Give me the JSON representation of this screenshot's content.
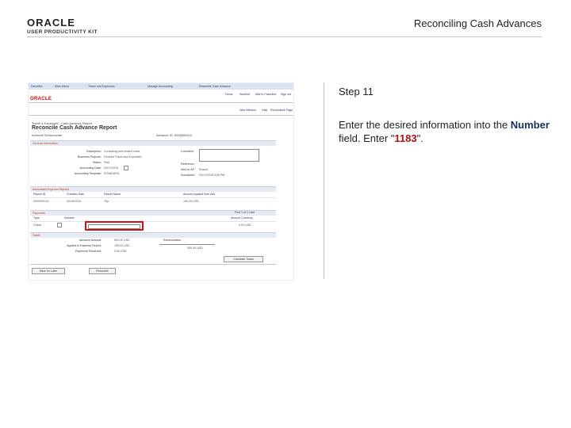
{
  "header": {
    "logo_text": "ORACLE",
    "logo_subtext": "USER PRODUCTIVITY KIT",
    "page_title": "Reconciling Cash Advances"
  },
  "instructions": {
    "step_label": "Step 11",
    "line_prefix": "Enter the desired information into the ",
    "field_name": "Number",
    "line_middle": " field. Enter \"",
    "entry_value": "1183",
    "line_suffix": "\"."
  },
  "screenshot": {
    "nav": [
      "Favorites",
      "Main Menu",
      "Travel and Expenses",
      "Manage Accounting",
      "Reconcile Cash Advance"
    ],
    "brand": "ORACLE",
    "top_links": [
      "Home",
      "Worklist",
      "Add to Favorites",
      "Sign out"
    ],
    "sub_links": [
      "New Window",
      "Help",
      "Personalize Page"
    ],
    "breadcrumb": "Travel & Expenses - Cash Advance Report",
    "title": "Reconcile Cash Advance Report",
    "person": "Kenneth Schumacher",
    "advance_id": "Advance ID:  0000000012",
    "general_info": "General Information",
    "fields": [
      {
        "label": "Description:",
        "value": "Consulting and related costs"
      },
      {
        "label": "Business Purpose:",
        "value": "General Travel and Expenses"
      },
      {
        "label": "Status:",
        "value": "Paid"
      },
      {
        "label": "Accounting Date:",
        "value": "03/17/2016"
      },
      {
        "label": "Accounting Template:",
        "value": "STANDARD"
      }
    ],
    "right_fields": [
      {
        "label": "Comment:",
        "value": ""
      },
      {
        "label": "Reference:",
        "value": ""
      },
      {
        "label": "Sent to AP:",
        "value": "Posted"
      },
      {
        "label": "Scheduled:",
        "value": "03/17/2016 9:00 PM"
      }
    ],
    "assoc_section": "Associated Expense Reports",
    "assoc_cols": [
      "Report ID",
      "Creation Date",
      "Report Name",
      "Amount Applied from Adv"
    ],
    "assoc_row": [
      "0000000141",
      "03/18/2016",
      "Trip",
      "150.00 USD"
    ],
    "pay_section": "Payments",
    "pay_cols": [
      "Type",
      "Number",
      "Amount Currency"
    ],
    "pay_row_type": "Check",
    "pay_row_amount": "0.00 USD",
    "pay_nav": "First 1 of 1 Last",
    "totals_section": "Totals",
    "totals": [
      {
        "label": "Advance Amount:",
        "value": "500.00 USD"
      },
      {
        "label": "Applied to Expense Report:",
        "value": "150.00 USD"
      },
      {
        "label": "Payments Received:",
        "value": "0.00 USD"
      }
    ],
    "recon_label": "Reconciliation",
    "recon_value": "350.00 USD",
    "buttons": [
      "Save for Later",
      "Reconcile"
    ],
    "calc_button": "Calculate Totals"
  }
}
